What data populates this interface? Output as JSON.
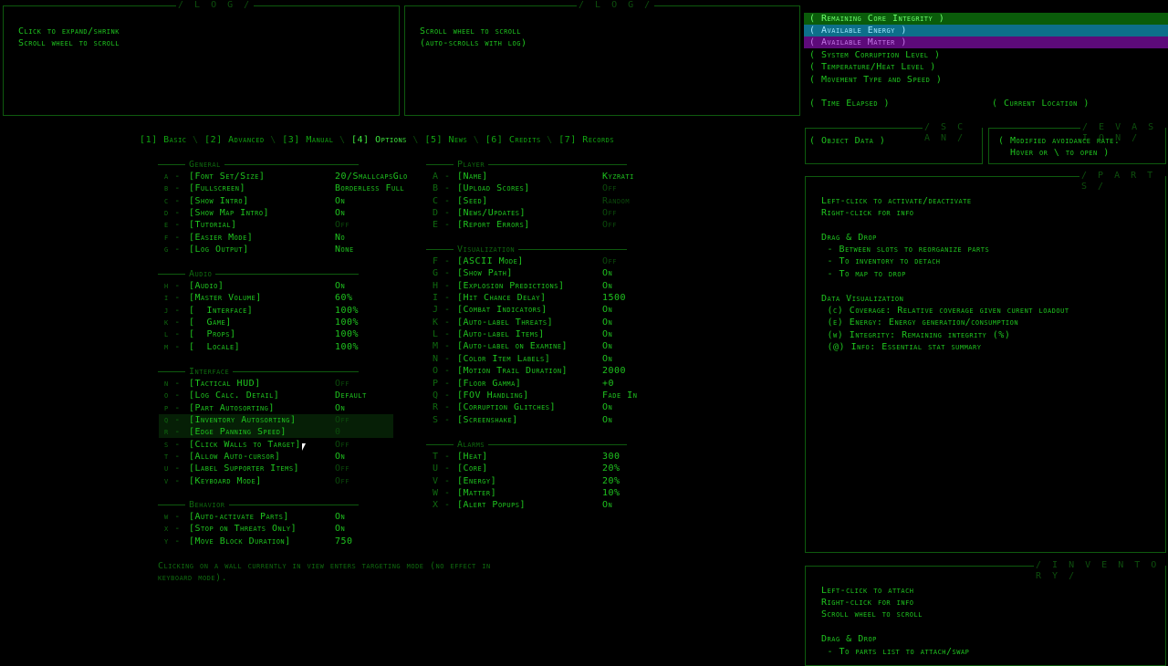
{
  "log_left": {
    "title": "/ L O G /",
    "lines": [
      "Click to expand/shrink",
      "Scroll wheel to scroll"
    ]
  },
  "log_right": {
    "title": "/ L O G /",
    "lines": [
      "Scroll wheel to scroll",
      "(auto-scrolls with log)"
    ]
  },
  "status": {
    "core": "( Remaining Core Integrity )",
    "energy": "( Available Energy )",
    "matter": "( Available Matter )",
    "corruption": "( System Corruption Level )",
    "heat": "( Temperature/Heat Level )",
    "movement": "( Movement Type and Speed )",
    "time": "( Time Elapsed )",
    "location": "( Current Location )",
    "colors": {
      "core": "#0a5c0a",
      "energy": "#0d6f8a",
      "matter": "#5d0a7a"
    }
  },
  "scan": {
    "title": "/ S C A N /",
    "text": "( Object Data )"
  },
  "evasion": {
    "title": "/ E V A S I O N /",
    "lines": [
      "( Modified avoidance rate.",
      "  Hover or \\ to open )"
    ]
  },
  "parts": {
    "title": "/ P A R T S /",
    "lines": [
      "Left-click to activate/deactivate",
      "Right-click for info",
      "",
      "Drag & Drop",
      " - Between slots to reorganize parts",
      " - To inventory to detach",
      " - To map to drop",
      "",
      "Data Visualization",
      " (c) Coverage: Relative coverage given curent loadout",
      " (e) Energy: Energy generation/consumption",
      " (w) Integrity: Remaining integrity (%)",
      " (@) Info: Essential stat summary"
    ]
  },
  "inventory": {
    "title": "/ I N V E N T O R Y /",
    "lines": [
      "Left-click to attach",
      "Right-click for info",
      "Scroll wheel to scroll",
      "",
      "Drag & Drop",
      " - To parts list to attach/swap"
    ]
  },
  "tabs": [
    {
      "label": "[1] Basic"
    },
    {
      "label": "[2] Advanced"
    },
    {
      "label": "[3] Manual"
    },
    {
      "label": "[4] Options"
    },
    {
      "label": "[5] News"
    },
    {
      "label": "[6] Credits"
    },
    {
      "label": "[7] Records"
    }
  ],
  "tab_separator": " \\ ",
  "sections": {
    "general": "General",
    "audio": "Audio",
    "interface": "Interface",
    "behavior": "Behavior",
    "player": "Player",
    "visualization": "Visualization",
    "alarms": "Alarms"
  },
  "general": [
    {
      "k": "a -",
      "n": "[Font Set/Size]",
      "v": "20/SmallcapsGlo"
    },
    {
      "k": "b -",
      "n": "[Fullscreen]",
      "v": "Borderless Full"
    },
    {
      "k": "c -",
      "n": "[Show Intro]",
      "v": "On"
    },
    {
      "k": "d -",
      "n": "[Show Map Intro]",
      "v": "On"
    },
    {
      "k": "e -",
      "n": "[Tutorial]",
      "v": "Off"
    },
    {
      "k": "f -",
      "n": "[Easier Mode]",
      "v": "No"
    },
    {
      "k": "g -",
      "n": "[Log Output]",
      "v": "None"
    }
  ],
  "audio": [
    {
      "k": "h -",
      "n": "[Audio]",
      "v": "On"
    },
    {
      "k": "i -",
      "n": "[Master Volume]",
      "v": "60%"
    },
    {
      "k": "j -",
      "n": "[  Interface]",
      "v": "100%"
    },
    {
      "k": "k -",
      "n": "[  Game]",
      "v": "100%"
    },
    {
      "k": "l -",
      "n": "[  Props]",
      "v": "100%"
    },
    {
      "k": "m -",
      "n": "[  Locale]",
      "v": "100%"
    }
  ],
  "interface": [
    {
      "k": "n -",
      "n": "[Tactical HUD]",
      "v": "Off"
    },
    {
      "k": "o -",
      "n": "[Log Calc. Detail]",
      "v": "Default"
    },
    {
      "k": "p -",
      "n": "[Part Autosorting]",
      "v": "On"
    },
    {
      "k": "q -",
      "n": "[Inventory Autosorting]",
      "v": "Off"
    },
    {
      "k": "r -",
      "n": "[Edge Panning Speed]",
      "v": "0"
    },
    {
      "k": "s -",
      "n": "[Click Walls to Target]",
      "v": "Off"
    },
    {
      "k": "t -",
      "n": "[Allow Auto-cursor]",
      "v": "On"
    },
    {
      "k": "u -",
      "n": "[Label Supporter Items]",
      "v": "Off"
    },
    {
      "k": "v -",
      "n": "[Keyboard Mode]",
      "v": "Off"
    }
  ],
  "behavior": [
    {
      "k": "w -",
      "n": "[Auto-activate Parts]",
      "v": "On"
    },
    {
      "k": "x -",
      "n": "[Stop on Threats Only]",
      "v": "On"
    },
    {
      "k": "y -",
      "n": "[Move Block Duration]",
      "v": "750"
    }
  ],
  "player": [
    {
      "k": "A -",
      "n": "[Name]",
      "v": "Kyzrati"
    },
    {
      "k": "B -",
      "n": "[Upload Scores]",
      "v": "Off"
    },
    {
      "k": "C -",
      "n": "[Seed]",
      "v": "Random"
    },
    {
      "k": "D -",
      "n": "[News/Updates]",
      "v": "Off"
    },
    {
      "k": "E -",
      "n": "[Report Errors]",
      "v": "Off"
    }
  ],
  "visualization": [
    {
      "k": "F -",
      "n": "[ASCII Mode]",
      "v": "Off"
    },
    {
      "k": "G -",
      "n": "[Show Path]",
      "v": "On"
    },
    {
      "k": "H -",
      "n": "[Explosion Predictions]",
      "v": "On"
    },
    {
      "k": "I -",
      "n": "[Hit Chance Delay]",
      "v": "1500"
    },
    {
      "k": "J -",
      "n": "[Combat Indicators]",
      "v": "On"
    },
    {
      "k": "K -",
      "n": "[Auto-label Threats]",
      "v": "On"
    },
    {
      "k": "L -",
      "n": "[Auto-label Items]",
      "v": "On"
    },
    {
      "k": "M -",
      "n": "[Auto-label on Examine]",
      "v": "On"
    },
    {
      "k": "N -",
      "n": "[Color Item Labels]",
      "v": "On"
    },
    {
      "k": "O -",
      "n": "[Motion Trail Duration]",
      "v": "2000"
    },
    {
      "k": "P -",
      "n": "[Floor Gamma]",
      "v": "+0"
    },
    {
      "k": "Q -",
      "n": "[FOV Handling]",
      "v": "Fade In"
    },
    {
      "k": "R -",
      "n": "[Corruption Glitches]",
      "v": "On"
    },
    {
      "k": "S -",
      "n": "[Screenshake]",
      "v": "On"
    }
  ],
  "alarms": [
    {
      "k": "T -",
      "n": "[Heat]",
      "v": "300"
    },
    {
      "k": "U -",
      "n": "[Core]",
      "v": "20%"
    },
    {
      "k": "V -",
      "n": "[Energy]",
      "v": "20%"
    },
    {
      "k": "W -",
      "n": "[Matter]",
      "v": "10%"
    },
    {
      "k": "X -",
      "n": "[Alert Popups]",
      "v": "On"
    }
  ],
  "help": [
    "Clicking on a wall currently in view enters targeting mode (no effect in",
    "keyboard mode)."
  ]
}
